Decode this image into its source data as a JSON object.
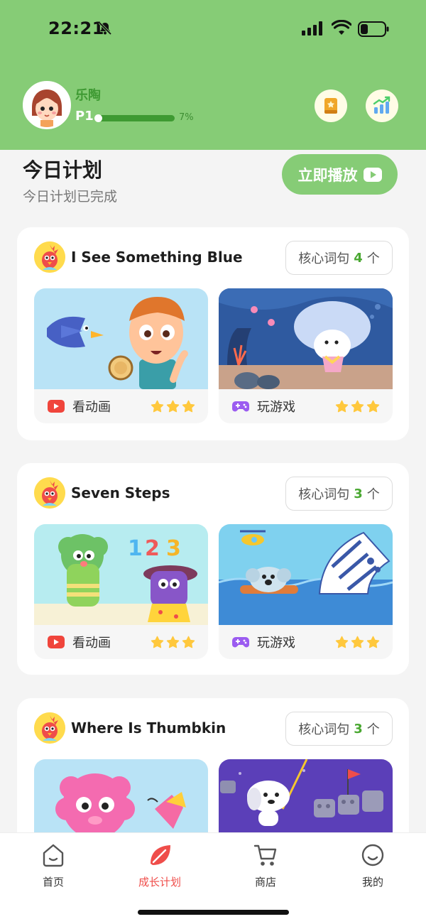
{
  "status_bar": {
    "time": "22:21"
  },
  "profile": {
    "name": "乐陶",
    "level": "P1",
    "progress_text": "7%",
    "progress_value": 0.07
  },
  "plan": {
    "title": "今日计划",
    "subtitle": "今日计划已完成",
    "play_label": "立即播放"
  },
  "cards": [
    {
      "title": "I See Something Blue",
      "core_prefix": "核心词句",
      "core_count": "4",
      "core_suffix": "个",
      "video": {
        "label": "看动画",
        "stars": 3
      },
      "game": {
        "label": "玩游戏",
        "stars": 3
      }
    },
    {
      "title": "Seven Steps",
      "core_prefix": "核心词句",
      "core_count": "3",
      "core_suffix": "个",
      "video": {
        "label": "看动画",
        "stars": 3
      },
      "game": {
        "label": "玩游戏",
        "stars": 3
      }
    },
    {
      "title": "Where Is Thumbkin",
      "core_prefix": "核心词句",
      "core_count": "3",
      "core_suffix": "个"
    }
  ],
  "tabs": [
    {
      "label": "首页",
      "icon": "home-icon"
    },
    {
      "label": "成长计划",
      "icon": "leaf-icon",
      "active": true
    },
    {
      "label": "商店",
      "icon": "cart-icon"
    },
    {
      "label": "我的",
      "icon": "smile-icon"
    }
  ],
  "colors": {
    "header_green": "#86cc76",
    "accent_red": "#ef4d4a",
    "count_green": "#4aa832",
    "star": "#ffc83d"
  }
}
